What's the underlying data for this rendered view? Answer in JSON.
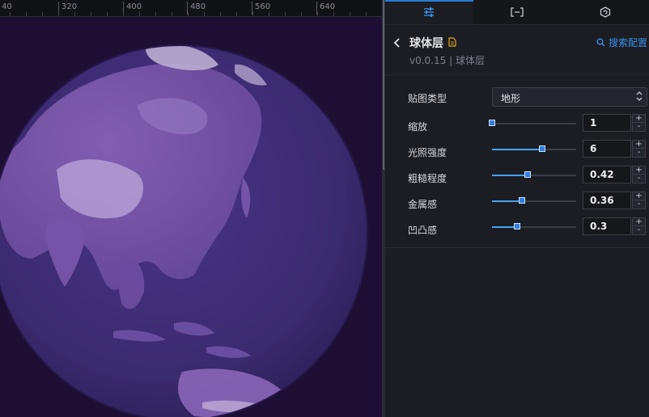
{
  "ruler": {
    "ticks": [
      "40",
      "320",
      "400",
      "480",
      "560",
      "640"
    ]
  },
  "tabs": [
    {
      "name": "settings-tab",
      "icon": "sliders-icon"
    },
    {
      "name": "data-tab",
      "icon": "brackets-icon"
    },
    {
      "name": "interaction-tab",
      "icon": "hexagon-refresh-icon"
    }
  ],
  "header": {
    "title": "球体层",
    "version": "v0.0.15 | 球体层",
    "search_label": "搜索配置"
  },
  "props": {
    "map_type": {
      "label": "贴图类型",
      "value": "地形"
    },
    "zoom": {
      "label": "缩放",
      "value": "1",
      "fraction": 0.0
    },
    "light": {
      "label": "光照强度",
      "value": "6",
      "fraction": 0.6
    },
    "rough": {
      "label": "粗糙程度",
      "value": "0.42",
      "fraction": 0.42
    },
    "metal": {
      "label": "金属感",
      "value": "0.36",
      "fraction": 0.36
    },
    "bump": {
      "label": "凹凸感",
      "value": "0.3",
      "fraction": 0.3
    }
  },
  "stepper": {
    "plus": "+",
    "minus": "-"
  },
  "colors": {
    "accent": "#2a7bd6",
    "link": "#3a8ee6",
    "globe": "#3a2a6e",
    "canvas_bg": "#1d0f34"
  }
}
